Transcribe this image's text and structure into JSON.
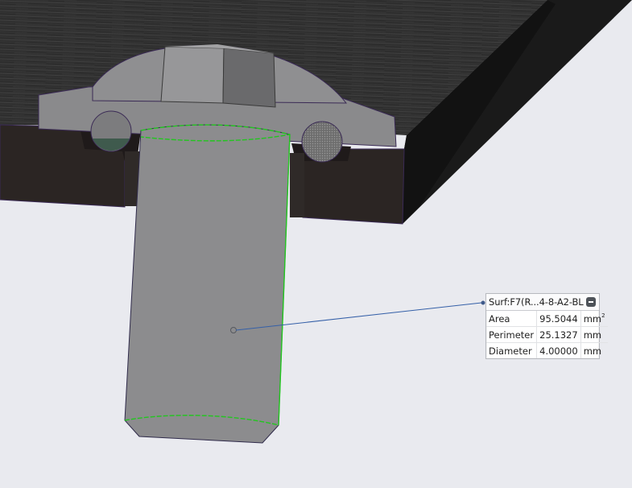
{
  "measurement": {
    "title": "Surf:F7(R...4-8-A2-BL",
    "rows": [
      {
        "label": "Area",
        "value": "95.5044",
        "unit": "mm",
        "unit_sup": "2"
      },
      {
        "label": "Perimeter",
        "value": "25.1327",
        "unit": "mm",
        "unit_sup": ""
      },
      {
        "label": "Diameter",
        "value": "4.00000",
        "unit": "mm",
        "unit_sup": ""
      }
    ]
  },
  "colors": {
    "background": "#e9eaef",
    "screw_body": "#8c8c8e",
    "plate": "#2b2523",
    "selection_edge": "#22c61f",
    "leader_line": "#3560a8"
  },
  "icons": {
    "collapse": "collapse-icon"
  }
}
